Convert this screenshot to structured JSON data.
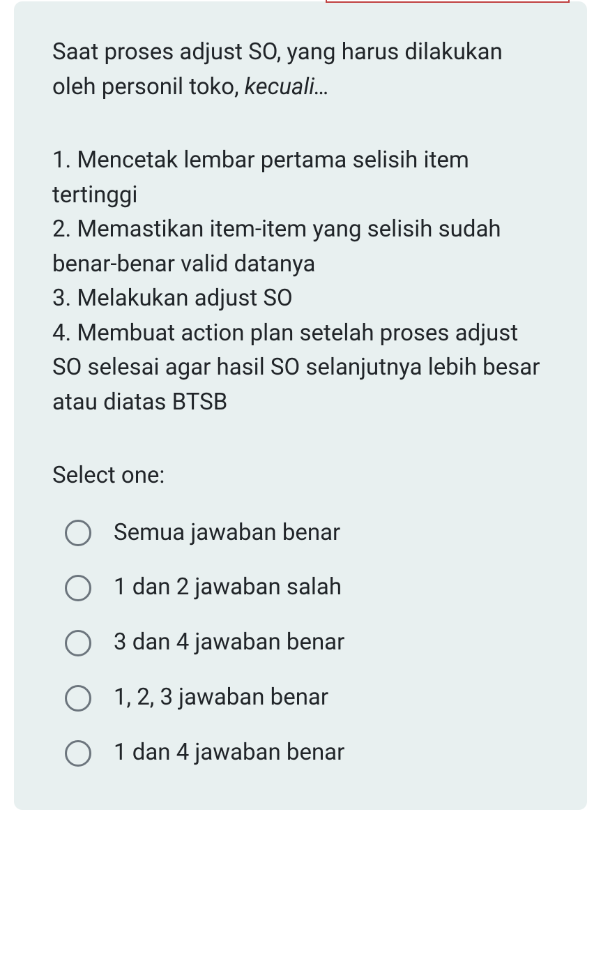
{
  "question": {
    "intro_part1": "Saat proses adjust SO, yang harus dilakukan oleh personil toko, ",
    "intro_italic": "kecuali…",
    "items": [
      "1. Mencetak lembar pertama selisih item tertinggi",
      "2. Memastikan item-item yang selisih sudah benar-benar valid datanya",
      "3. Melakukan adjust SO",
      "4. Membuat action plan setelah proses adjust SO selesai agar hasil SO selanjutnya lebih besar atau diatas BTSB"
    ],
    "select_label": "Select one:",
    "options": [
      "Semua jawaban benar",
      "1 dan 2 jawaban salah",
      "3 dan 4 jawaban benar",
      "1, 2, 3 jawaban benar",
      "1 dan 4 jawaban benar"
    ]
  }
}
